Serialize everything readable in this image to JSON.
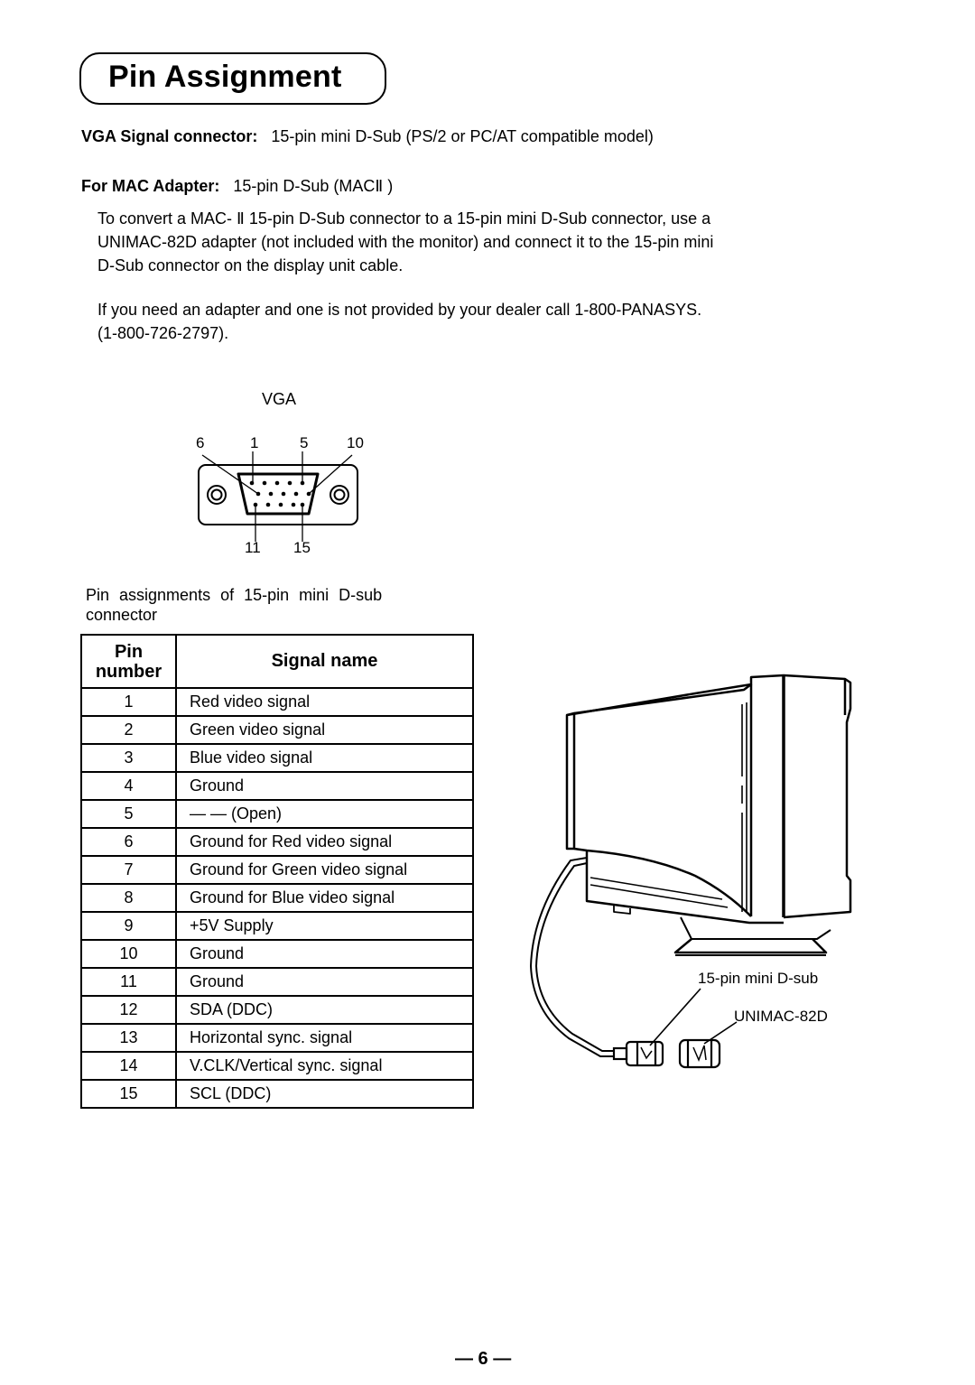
{
  "header": {
    "title": "Pin Assignment"
  },
  "connectors": {
    "vga_label": "VGA Signal connector:",
    "vga_value": "15-pin mini D-Sub (PS/2 or PC/AT compatible model)",
    "mac_label": "For MAC Adapter:",
    "mac_value": "15-pin D-Sub (MACⅡ )"
  },
  "paragraphs": {
    "convert_lines": [
      "To convert a MAC- Ⅱ  15-pin D-Sub connector to a 15-pin mini D-Sub connector, use a",
      "UNIMAC-82D adapter (not included with the monitor) and connect it to the 15-pin mini",
      "D-Sub connector on the display unit cable."
    ],
    "dealer_lines": [
      "If you need an adapter and one is not provided by your dealer call  1-800-PANASYS.",
      "(1-800-726-2797)."
    ]
  },
  "vga_diagram": {
    "title": "VGA",
    "top_pin_labels": [
      "6",
      "1",
      "5",
      "10"
    ],
    "bottom_pin_labels": [
      "11",
      "15"
    ]
  },
  "table": {
    "caption_lines": [
      "Pin  assignments  of  15-pin  mini  D-sub",
      "connector"
    ],
    "header_pin_line1": "Pin",
    "header_pin_line2": "number",
    "header_signal": "Signal name",
    "rows": [
      {
        "pin": "1",
        "signal": "Red video signal"
      },
      {
        "pin": "2",
        "signal": "Green video signal"
      },
      {
        "pin": "3",
        "signal": "Blue video signal"
      },
      {
        "pin": "4",
        "signal": "Ground"
      },
      {
        "pin": "5",
        "signal": "— — (Open)"
      },
      {
        "pin": "6",
        "signal": "Ground for Red video signal"
      },
      {
        "pin": "7",
        "signal": "Ground for Green video signal"
      },
      {
        "pin": "8",
        "signal": "Ground for Blue video signal"
      },
      {
        "pin": "9",
        "signal": "+5V Supply"
      },
      {
        "pin": "10",
        "signal": "Ground"
      },
      {
        "pin": "11",
        "signal": "Ground"
      },
      {
        "pin": "12",
        "signal": "SDA (DDC)"
      },
      {
        "pin": "13",
        "signal": "Horizontal sync. signal"
      },
      {
        "pin": "14",
        "signal": "V.CLK/Vertical sync. signal"
      },
      {
        "pin": "15",
        "signal": "SCL (DDC)"
      }
    ]
  },
  "monitor_illustration": {
    "label_connector": "15-pin  mini  D-sub",
    "label_adapter": "UNIMAC-82D"
  },
  "footer": {
    "page_number": "— 6 —"
  }
}
